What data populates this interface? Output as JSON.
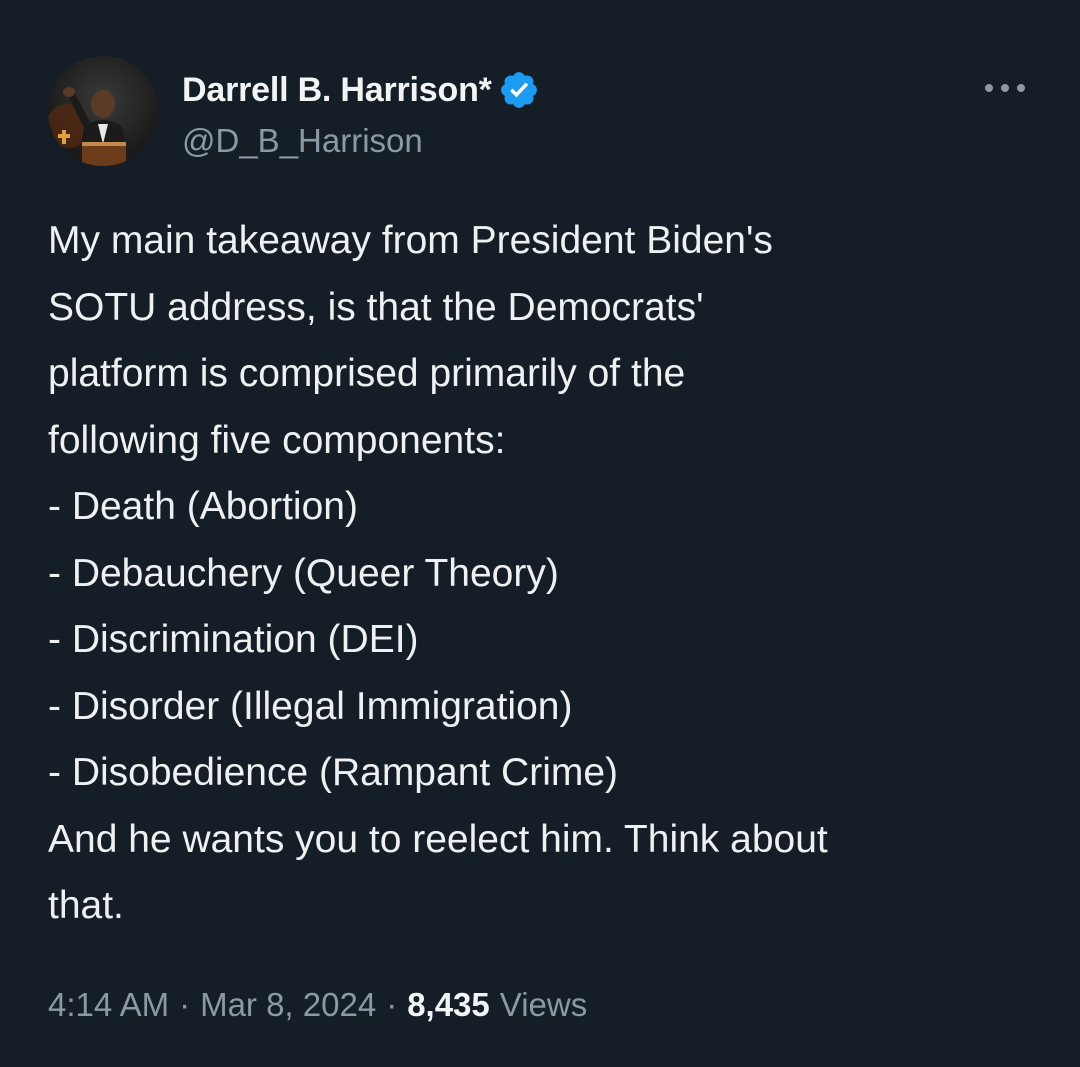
{
  "author": {
    "display_name": "Darrell B. Harrison*",
    "handle": "@D_B_Harrison",
    "verified": true,
    "verified_color": "#1d9bf0"
  },
  "tweet": {
    "lines": [
      "My main takeaway from President Biden's",
      "SOTU address, is that the Democrats'",
      "platform is comprised primarily of the",
      "following five components:",
      "- Death (Abortion)",
      "- Debauchery (Queer Theory)",
      "- Discrimination (DEI)",
      "- Disorder (Illegal Immigration)",
      "- Disobedience (Rampant Crime)",
      "And he wants you to reelect him. Think about",
      "that."
    ]
  },
  "meta": {
    "time": "4:14 AM",
    "separator": "·",
    "date": "Mar 8, 2024",
    "views_count": "8,435",
    "views_label": "Views"
  },
  "icons": {
    "verified": "verified-badge-icon",
    "more": "more-horizontal-icon"
  },
  "colors": {
    "background": "#151d26",
    "primary_text": "#e7e9ea",
    "secondary_text": "#8b98a5"
  }
}
